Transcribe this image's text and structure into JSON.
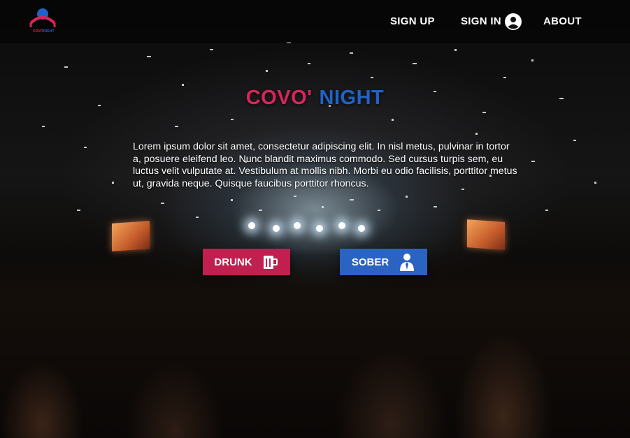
{
  "nav": {
    "links": [
      {
        "label": "SIGN UP"
      },
      {
        "label": "SIGN IN"
      },
      {
        "label": "ABOUT"
      }
    ],
    "user_icon": "user-circle-icon"
  },
  "logo": {
    "icon": "covo-night-logo",
    "text_left": "COVO",
    "text_right": "NIGHT",
    "colors": {
      "red": "#d8265a",
      "blue": "#1f63c7"
    }
  },
  "hero": {
    "brand_word1": "COVO'",
    "brand_word2": "NIGHT",
    "intro": "Lorem ipsum dolor sit amet, consectetur adipiscing elit. In nisl metus, pulvinar in tortor a, posuere eleifend leo. Nunc blandit maximus commodo. Sed cursus turpis sem, eu luctus velit vulputate at. Vestibulum at mollis nibh. Morbi eu odio facilisis, porttitor metus ut, gravida neque. Quisque faucibus porttitor rhoncus."
  },
  "actions": {
    "drunk": {
      "label": "DRUNK",
      "icon": "beer-mug-icon",
      "color": "#c0204f"
    },
    "sober": {
      "label": "SOBER",
      "icon": "person-tie-icon",
      "color": "#2a63c2"
    }
  }
}
